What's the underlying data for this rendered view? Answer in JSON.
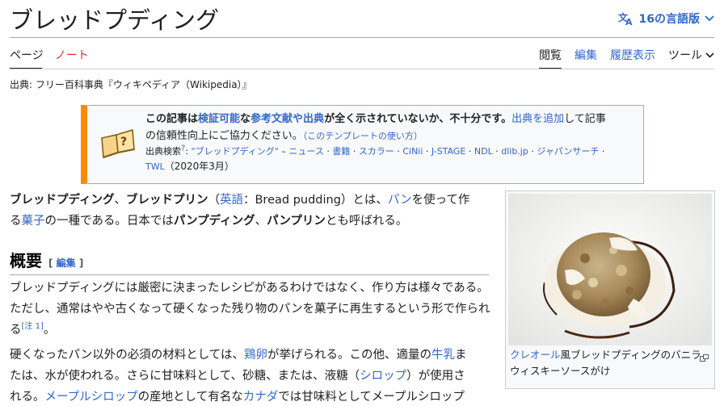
{
  "page": {
    "title": "ブレッドプディング",
    "languages_label": "16の言語版"
  },
  "tabs": {
    "page": "ページ",
    "talk": "ノート",
    "read": "閲覧",
    "edit": "編集",
    "history": "履歴表示",
    "tools": "ツール"
  },
  "source_line": "出典: フリー百科事典『ウィキペディア（Wikipedia）』",
  "ambox": {
    "line1_a": "この記事は",
    "line1_link1": "検証可能",
    "line1_b": "な",
    "line1_link2": "参考文献や出典",
    "line1_c": "が全く示されていないか、不十分です。",
    "line1_link3": "出典を追加",
    "line1_d": "して記事",
    "line2": "の信頼性向上にご協力ください。",
    "line2_link": "（このテンプレートの使い方）",
    "search_label": "出典検索",
    "search_sup": "?",
    "search_query": "\"ブレッドプディング\"",
    "search_dash": " – ",
    "search_links": [
      "ニュース",
      "書籍",
      "スカラー",
      "CiNii",
      "J-STAGE",
      "NDL",
      "dlib.jp",
      "ジャパンサーチ",
      "TWL"
    ],
    "date": "（2020年3月）"
  },
  "intro": {
    "b1": "ブレッドプディング",
    "sep1": "、",
    "b2": "ブレッドプリン",
    "paren_open": "（",
    "lang_link": "英語",
    "lang_rest": "：Bread pudding）とは、",
    "bread_link": "パン",
    "rest1": "を使って作",
    "line2_link": "菓子",
    "rest2": "の一種である。日本では",
    "b3": "パンプディング",
    "sep2": "、",
    "b4": "パンプリン",
    "rest3": "とも呼ばれる。"
  },
  "section": {
    "heading": "概要",
    "edit_open": "[ ",
    "edit_label": "編集",
    "edit_close": " ]"
  },
  "overview": {
    "p1": "ブレッドプディングには厳密に決まったレシピがあるわけではなく、作り方は様々である。ただし、通常はやや古くなって硬くなった残り物のパンを菓子に再生するという形で作られる",
    "note": "[注 1]",
    "p1_end": "。",
    "p2_a": "硬くなったパン以外の必須の材料としては、",
    "egg": "鶏卵",
    "p2_b": "が挙げられる。この他、適量の",
    "milk": "牛乳",
    "p2_c": "ま",
    "p2_line2a": "たは、水が使われる。さらに甘味料として、砂糖、または、液糖（",
    "syrup": "シロップ",
    "p2_line2b": "）が使用さ",
    "p2_line3a": "れる。",
    "maple": "メープルシロップ",
    "p2_line3b": "の産地として有名な",
    "canada": "カナダ",
    "p2_line3c": "では甘味料としてメープルシロップ"
  },
  "thumb": {
    "caption_link": "クレオール",
    "caption_text": "風ブレッドプディングのバニラウィスキーソースがけ"
  },
  "colors": {
    "link": "#3366cc",
    "ambox_accent": "#fc8b00",
    "talk_red": "#d73333"
  }
}
